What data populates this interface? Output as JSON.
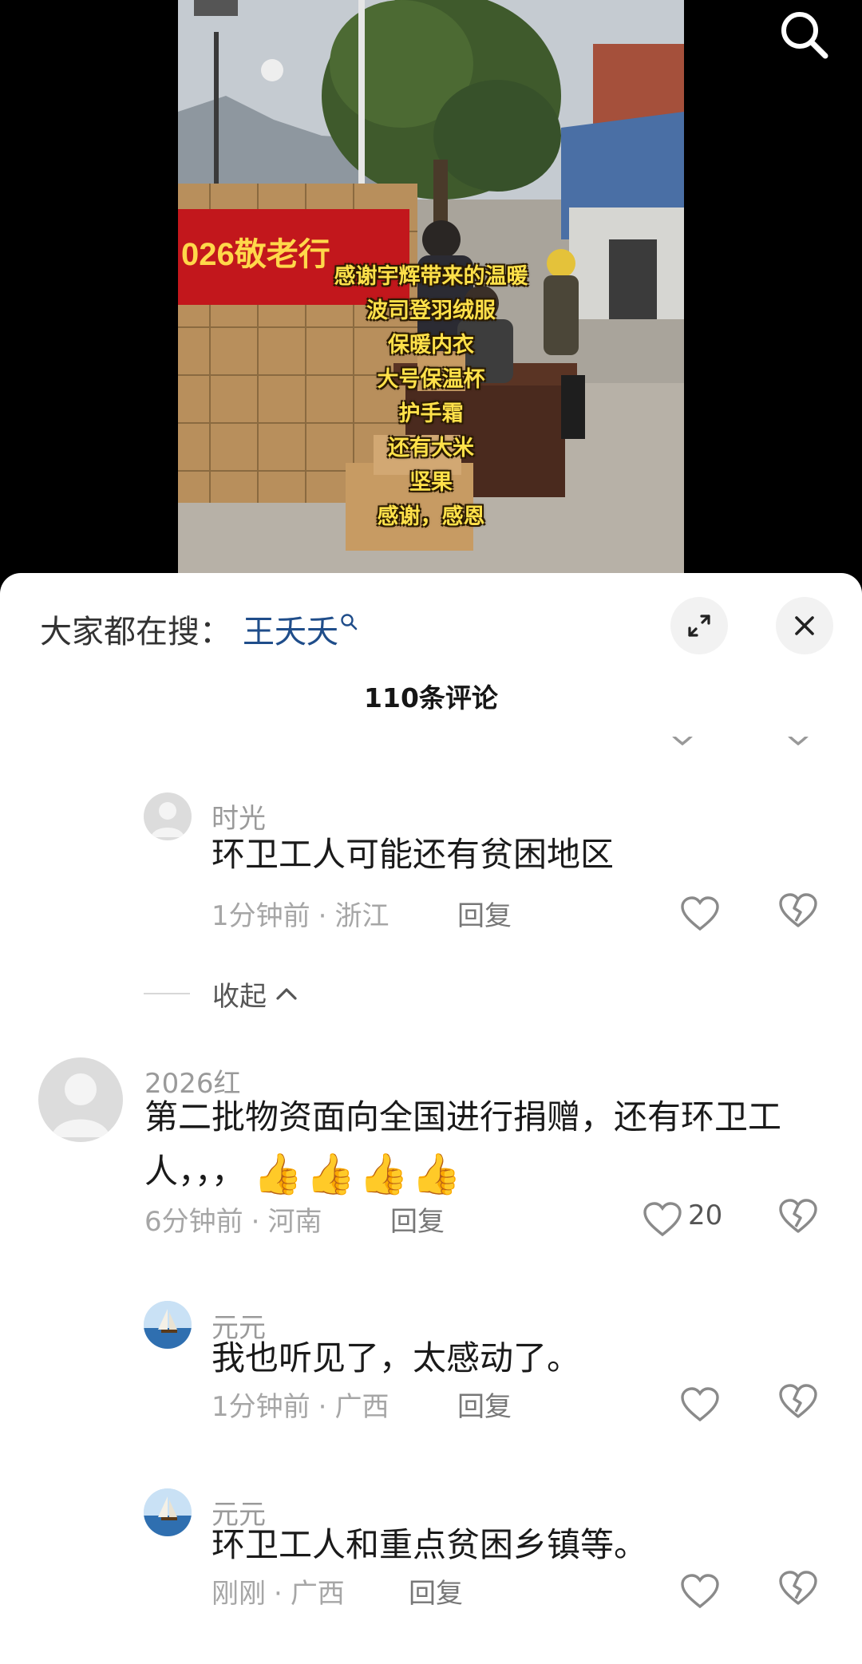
{
  "video": {
    "overlay_lines": [
      "感谢宇辉带来的温暖",
      "波司登羽绒服",
      "保暖内衣",
      "大号保温杯",
      "护手霜",
      "还有大米",
      "坚果",
      "感谢，感恩"
    ],
    "banner_text": "026敬老行"
  },
  "search_icon": "search-icon",
  "sheet": {
    "trending_label": "大家都在搜：",
    "trending_term": "王夭夭",
    "title": "110条评论"
  },
  "comments": [
    {
      "user": "时光",
      "text": "环卫工人可能还有贫困地区",
      "time": "1分钟前",
      "location": "浙江",
      "reply": "回复"
    },
    {
      "user": "2026红",
      "text": "第二批物资面向全国进行捐赠，还有环卫工人，，，",
      "emoji": [
        "👍",
        "👍",
        "👍",
        "👍"
      ],
      "time": "6分钟前",
      "location": "河南",
      "reply": "回复",
      "likes": "20"
    },
    {
      "user": "元元",
      "text": "我也听见了，太感动了。",
      "time": "1分钟前",
      "location": "广西",
      "reply": "回复"
    },
    {
      "user": "元元",
      "text": "环卫工人和重点贫困乡镇等。",
      "time": "刚刚",
      "location": "广西",
      "reply": "回复"
    }
  ],
  "collapse_label": "收起",
  "separator": "·",
  "colors": {
    "accent_link": "#1f4d8a",
    "overlay_text": "#ffe14a",
    "banner_red": "#c2171c"
  }
}
